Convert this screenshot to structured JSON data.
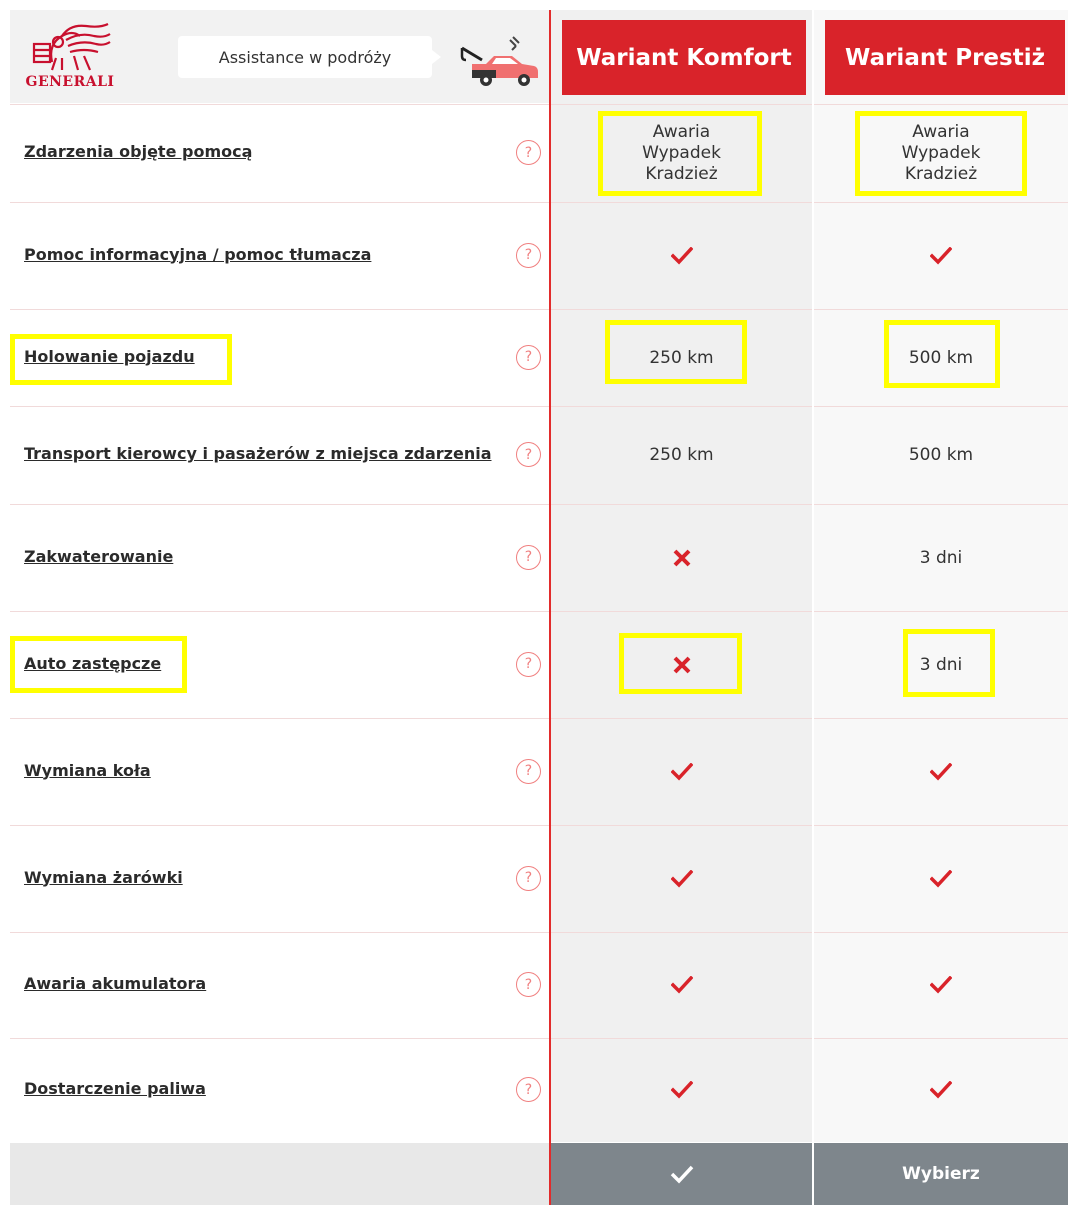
{
  "header": {
    "brand": "GENERALI",
    "product_label": "Assistance w podróży",
    "variants": [
      {
        "label": "Wariant Komfort"
      },
      {
        "label": "Wariant Prestiż"
      }
    ]
  },
  "rows": [
    {
      "feature": "Zdarzenia objęte pomocą",
      "komfort": [
        "Awaria",
        "Wypadek",
        "Kradzież"
      ],
      "prestiz": [
        "Awaria",
        "Wypadek",
        "Kradzież"
      ]
    },
    {
      "feature": "Pomoc informacyjna / pomoc tłumacza",
      "komfort": "check",
      "prestiz": "check"
    },
    {
      "feature": "Holowanie pojazdu",
      "komfort": "250 km",
      "prestiz": "500 km"
    },
    {
      "feature": "Transport kierowcy i pasażerów z miejsca zdarzenia",
      "komfort": "250 km",
      "prestiz": "500 km"
    },
    {
      "feature": "Zakwaterowanie",
      "komfort": "cross",
      "prestiz": "3 dni"
    },
    {
      "feature": "Auto zastępcze",
      "komfort": "cross",
      "prestiz": "3 dni"
    },
    {
      "feature": "Wymiana koła",
      "komfort": "check",
      "prestiz": "check"
    },
    {
      "feature": "Wymiana żarówki",
      "komfort": "check",
      "prestiz": "check"
    },
    {
      "feature": "Awaria akumulatora",
      "komfort": "check",
      "prestiz": "check"
    },
    {
      "feature": "Dostarczenie paliwa",
      "komfort": "check",
      "prestiz": "check"
    }
  ],
  "help_glyph": "?",
  "footer": {
    "prestiz_label": "Wybierz"
  },
  "colors": {
    "brand_red": "#d9232a",
    "highlight": "#ffff00",
    "footer_gray": "#7e868c"
  },
  "icons": {
    "selected": "check-icon",
    "included": "check-icon",
    "excluded": "cross-icon",
    "help": "question-circle-icon"
  }
}
